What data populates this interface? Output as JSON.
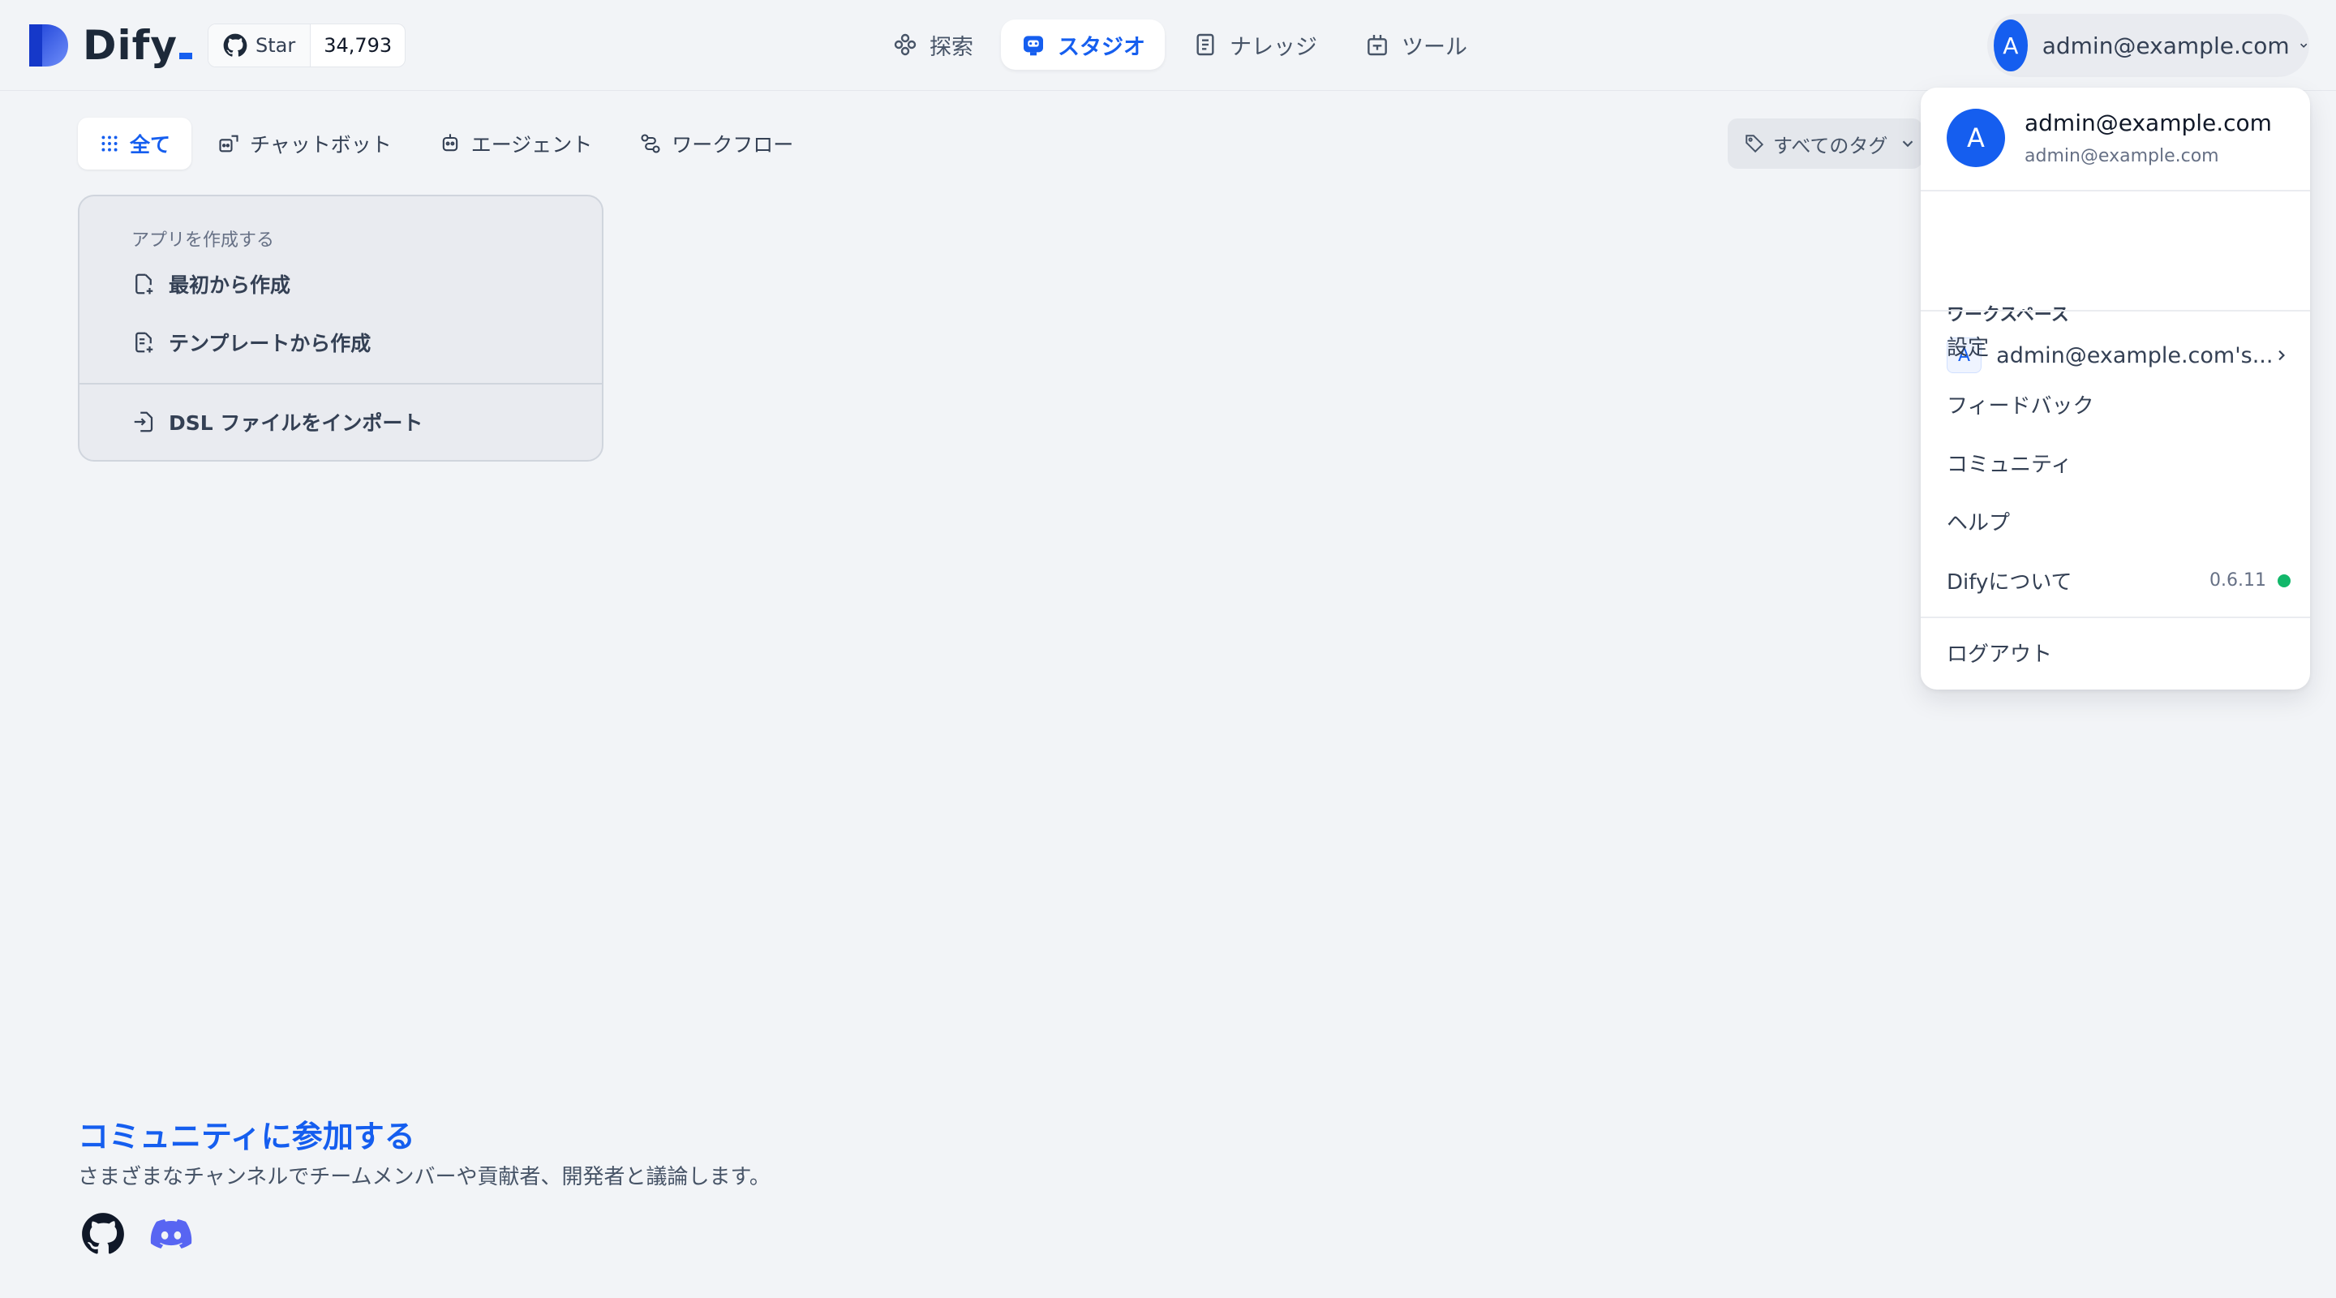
{
  "header": {
    "logo_text": "Dify",
    "github": {
      "star_label": "Star",
      "star_count": "34,793"
    },
    "nav": [
      {
        "label": "探索",
        "icon": "explore-icon"
      },
      {
        "label": "スタジオ",
        "icon": "robot-icon",
        "active": true
      },
      {
        "label": "ナレッジ",
        "icon": "book-icon"
      },
      {
        "label": "ツール",
        "icon": "tools-icon"
      }
    ],
    "account": {
      "avatar_letter": "A",
      "email": "admin@example.com"
    }
  },
  "tabs": [
    {
      "label": "全て",
      "icon": "grid-icon",
      "active": true
    },
    {
      "label": "チャットボット",
      "icon": "chat-bot-icon"
    },
    {
      "label": "エージェント",
      "icon": "agent-icon"
    },
    {
      "label": "ワークフロー",
      "icon": "workflow-icon"
    }
  ],
  "tag_filter": {
    "label": "すべてのタグ"
  },
  "create_card": {
    "heading": "アプリを作成する",
    "from_scratch": "最初から作成",
    "from_template": "テンプレートから作成",
    "import_dsl": "DSL ファイルをインポート"
  },
  "community": {
    "title": "コミュニティに参加する",
    "description": "さまざまなチャンネルでチームメンバーや貢献者、開発者と議論します。"
  },
  "dropdown": {
    "user": {
      "avatar_letter": "A",
      "name": "admin@example.com",
      "email": "admin@example.com"
    },
    "workspace_label": "ワークスペース",
    "workspace": {
      "badge": "A",
      "name": "admin@example.com's..."
    },
    "items": {
      "settings": "設定",
      "feedback": "フィードバック",
      "community": "コミュニティ",
      "help": "ヘルプ",
      "about": "Difyについて",
      "version": "0.6.11",
      "logout": "ログアウト"
    }
  },
  "colors": {
    "accent": "#155eef",
    "background": "#f2f4f7",
    "status_ok": "#12b76a",
    "discord": "#5865f2"
  }
}
